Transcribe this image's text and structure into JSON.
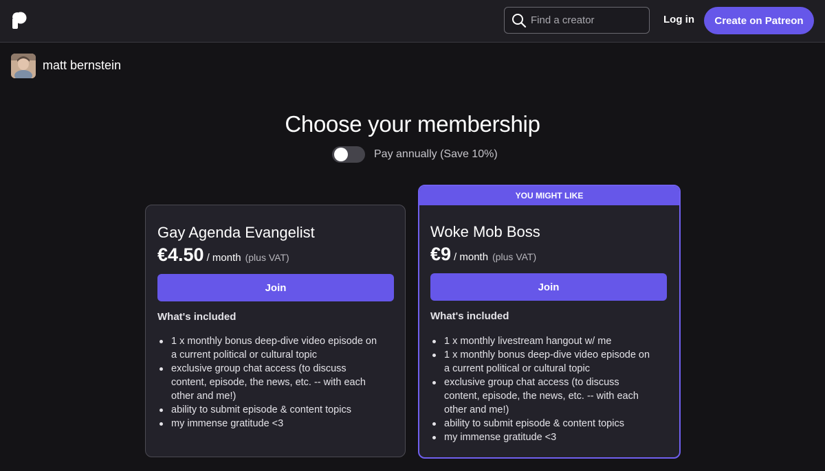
{
  "header": {
    "logo": "patreon-logo",
    "search_placeholder": "Find a creator",
    "login_label": "Log in",
    "create_label": "Create on Patreon"
  },
  "creator": {
    "name": "matt bernstein"
  },
  "page": {
    "title": "Choose your membership",
    "toggle_label": "Pay annually (Save 10%)",
    "toggle_on": false
  },
  "tiers": [
    {
      "banner": "",
      "title": "Gay Agenda Evangelist",
      "price": "€4.50",
      "period": "/ month",
      "vat": "(plus VAT)",
      "join_label": "Join",
      "included_label": "What's included",
      "benefits": [
        "1 x monthly bonus deep-dive video episode on a current political or cultural topic",
        "exclusive group chat access (to discuss content, episode, the news, etc. -- with each other and me!)",
        "ability to submit episode & content topics",
        "my immense gratitude <3"
      ]
    },
    {
      "banner": "YOU MIGHT LIKE",
      "title": "Woke Mob Boss",
      "price": "€9",
      "period": "/ month",
      "vat": "(plus VAT)",
      "join_label": "Join",
      "included_label": "What's included",
      "benefits": [
        "1 x monthly livestream hangout w/ me",
        "1 x monthly bonus deep-dive video episode on a current political or cultural topic",
        "exclusive group chat access (to discuss content, episode, the news, etc. -- with each other and me!)",
        "ability to submit episode & content topics",
        "my immense gratitude <3"
      ]
    }
  ],
  "colors": {
    "accent": "#6657e9",
    "background": "#141316",
    "card": "#23222a"
  }
}
